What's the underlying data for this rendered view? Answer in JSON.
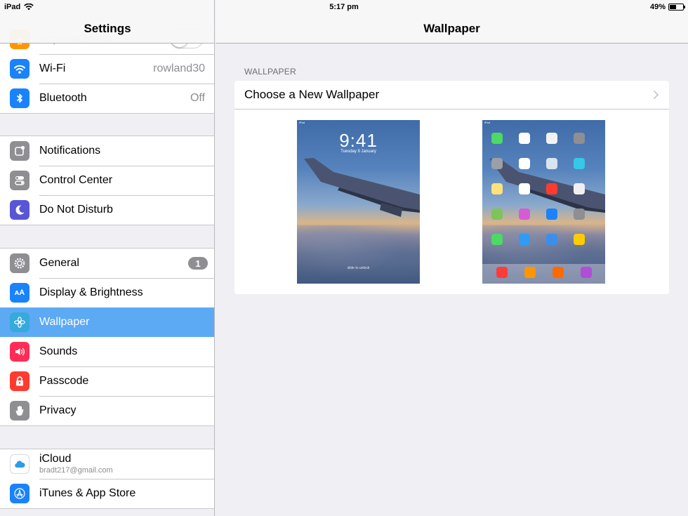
{
  "status_bar": {
    "device": "iPad",
    "time": "5:17 pm",
    "battery": "49%",
    "battery_level": 0.49
  },
  "sidebar": {
    "title": "Settings",
    "group0": [
      {
        "id": "airplane",
        "label": "Airplane Mode",
        "icon": "airplane-icon",
        "color": "#ff9500",
        "toggle": false
      },
      {
        "id": "wifi",
        "label": "Wi-Fi",
        "value": "rowland30",
        "icon": "wifi-icon",
        "color": "#1a82fb"
      },
      {
        "id": "bluetooth",
        "label": "Bluetooth",
        "value": "Off",
        "icon": "bluetooth-icon",
        "color": "#1a82fb"
      }
    ],
    "group1": [
      {
        "id": "notifications",
        "label": "Notifications",
        "icon": "notifications-icon",
        "color": "#8e8e93"
      },
      {
        "id": "control-center",
        "label": "Control Center",
        "icon": "control-center-icon",
        "color": "#8e8e93"
      },
      {
        "id": "do-not-disturb",
        "label": "Do Not Disturb",
        "icon": "moon-icon",
        "color": "#5856d6"
      }
    ],
    "group2": [
      {
        "id": "general",
        "label": "General",
        "badge": "1",
        "icon": "gear-icon",
        "color": "#8e8e93"
      },
      {
        "id": "display",
        "label": "Display & Brightness",
        "icon": "display-brightness-icon",
        "color": "#1a82fb"
      },
      {
        "id": "wallpaper",
        "label": "Wallpaper",
        "icon": "wallpaper-icon",
        "color": "#36aadc",
        "selected": true
      },
      {
        "id": "sounds",
        "label": "Sounds",
        "icon": "speaker-icon",
        "color": "#ff2d55"
      },
      {
        "id": "passcode",
        "label": "Passcode",
        "icon": "lock-icon",
        "color": "#ff3b30"
      },
      {
        "id": "privacy",
        "label": "Privacy",
        "icon": "hand-icon",
        "color": "#8e8e93"
      }
    ],
    "group3": [
      {
        "id": "icloud",
        "label": "iCloud",
        "sublabel": "bradt217@gmail.com",
        "icon": "icloud-icon",
        "color": "#ffffff"
      },
      {
        "id": "itunes",
        "label": "iTunes & App Store",
        "icon": "app-store-icon",
        "color": "#1a82fb"
      }
    ]
  },
  "detail": {
    "title": "Wallpaper",
    "section_header": "WALLPAPER",
    "choose_label": "Choose a New Wallpaper",
    "lock_preview": {
      "time": "9:41",
      "date": "Tuesday 9 January",
      "slide": "slide to unlock",
      "status": "iPad"
    },
    "home_preview": {
      "status": "iPad",
      "app_colors": [
        "#4cd964",
        "#ffffff",
        "#f2f2f2",
        "#8e8e93",
        "#9aa0a6",
        "#ffffff",
        "#d8e4f0",
        "#35c8e8",
        "#ffe27a",
        "#ffffff",
        "#ff3b30",
        "#f0f0f0",
        "#7fc35b",
        "#d65cd6",
        "#1a82fb",
        "#8e8e93",
        "#4cd964",
        "#2f9bf3",
        "#3b8fea",
        "#ffcc00"
      ],
      "dock_colors": [
        "#fc3d39",
        "#ff9500",
        "#ff6a00",
        "#b04ed8"
      ]
    }
  }
}
